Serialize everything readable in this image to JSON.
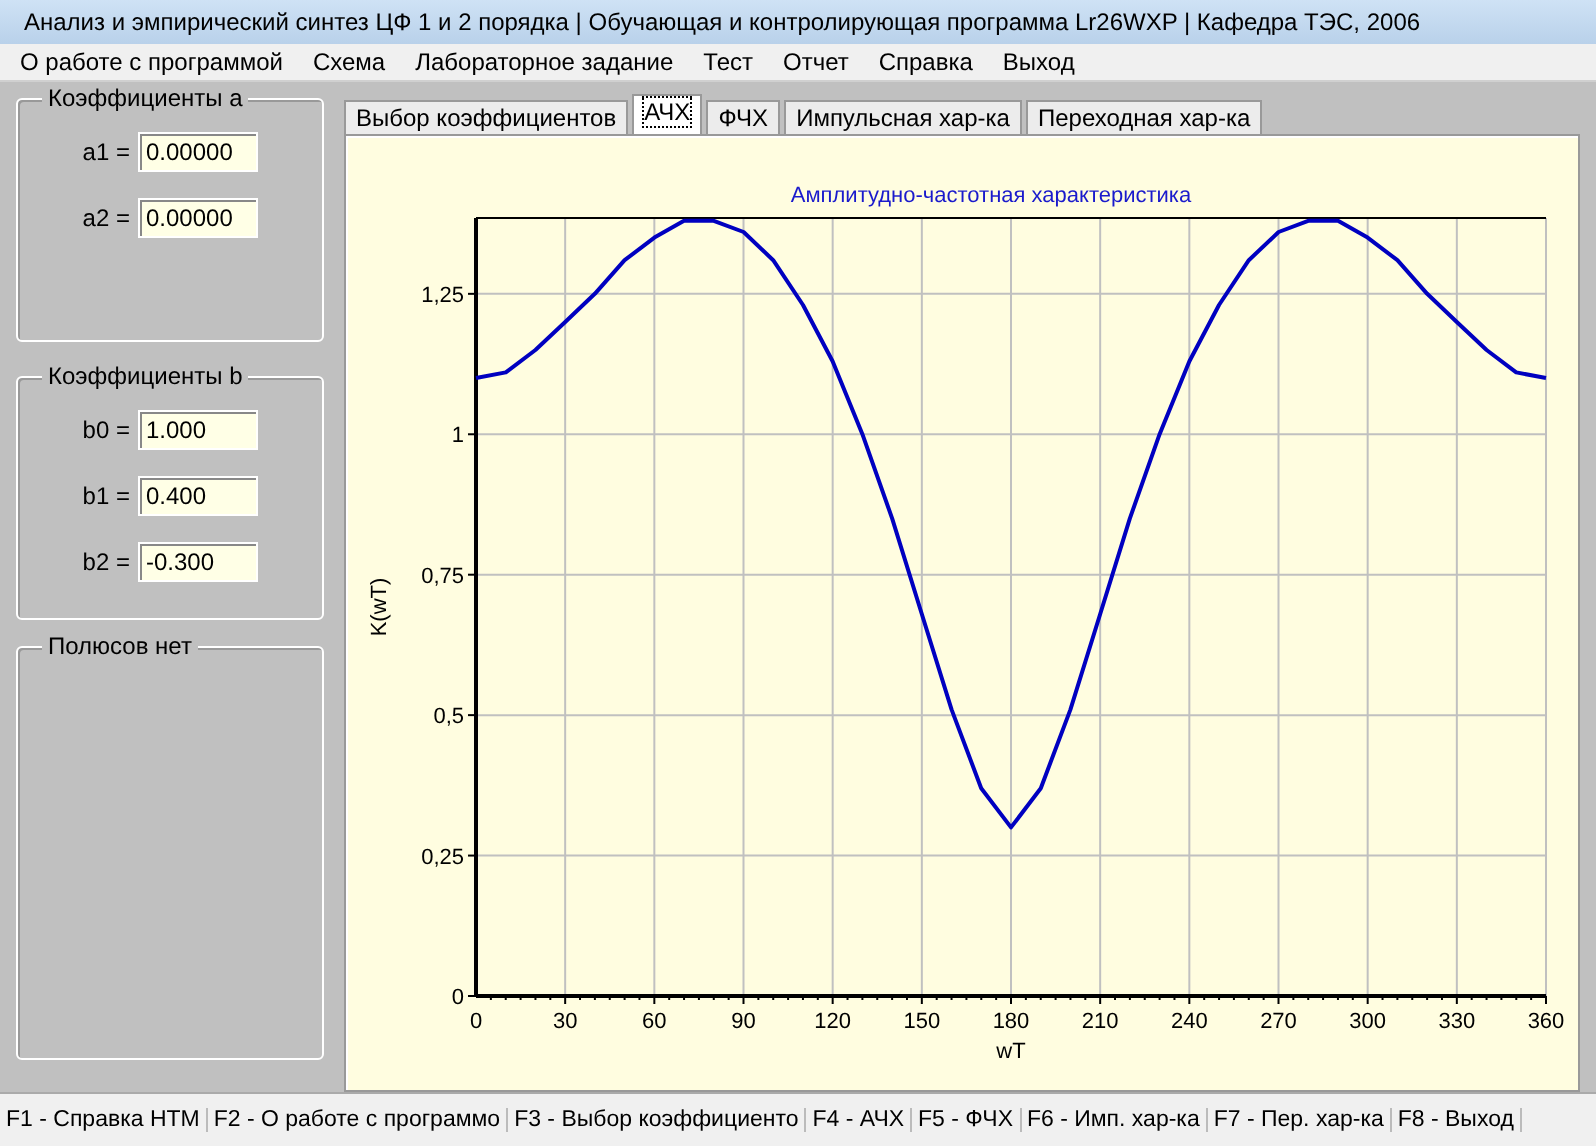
{
  "window": {
    "title": "Анализ и эмпирический синтез ЦФ 1 и 2 порядка | Обучающая и контролирующая программа Lr26WXP | Кафедра ТЭС, 2006"
  },
  "menu": [
    "О работе с программой",
    "Схема",
    "Лабораторное задание",
    "Тест",
    "Отчет",
    "Справка",
    "Выход"
  ],
  "groups": [
    {
      "title": "Коэффициенты  a",
      "fields": [
        {
          "label": "a1 =",
          "value": "0.00000"
        },
        {
          "label": "a2 =",
          "value": "0.00000"
        }
      ]
    },
    {
      "title": "Коэффициенты  b",
      "fields": [
        {
          "label": "b0 =",
          "value": "1.000"
        },
        {
          "label": "b1 =",
          "value": "0.400"
        },
        {
          "label": "b2 =",
          "value": "-0.300"
        }
      ]
    },
    {
      "title": "Полюсов нет"
    }
  ],
  "tabs": [
    {
      "label": "Выбор коэффициентов",
      "selected": false
    },
    {
      "label": "АЧХ",
      "selected": true
    },
    {
      "label": "ФЧХ",
      "selected": false
    },
    {
      "label": "Импульсная хар-ка",
      "selected": false
    },
    {
      "label": "Переходная хар-ка",
      "selected": false
    }
  ],
  "chart_data": {
    "type": "line",
    "title": "Амплитудно-частотная характеристика",
    "xlabel": "wT",
    "ylabel": "K(wT)",
    "x": [
      0,
      10,
      20,
      30,
      40,
      50,
      60,
      70,
      80,
      90,
      100,
      110,
      120,
      130,
      140,
      150,
      160,
      170,
      180,
      190,
      200,
      210,
      220,
      230,
      240,
      250,
      260,
      270,
      280,
      290,
      300,
      310,
      320,
      330,
      340,
      350,
      360
    ],
    "series": [
      {
        "color": "#0000c0",
        "values": [
          1.1,
          1.11,
          1.15,
          1.2,
          1.25,
          1.31,
          1.35,
          1.38,
          1.38,
          1.36,
          1.31,
          1.23,
          1.13,
          1,
          0.85,
          0.68,
          0.51,
          0.37,
          0.3,
          0.37,
          0.51,
          0.68,
          0.85,
          1,
          1.13,
          1.23,
          1.31,
          1.36,
          1.38,
          1.38,
          1.35,
          1.31,
          1.25,
          1.2,
          1.15,
          1.11,
          1.1
        ]
      }
    ],
    "grid": true,
    "xlim": [
      0,
      360
    ],
    "ylim": [
      0,
      1.385
    ],
    "xticks": [
      0,
      30,
      60,
      90,
      120,
      150,
      180,
      210,
      240,
      270,
      300,
      330,
      360
    ],
    "yticks": [
      {
        "value": 0,
        "label": "0"
      },
      {
        "value": 0.25,
        "label": "0,25"
      },
      {
        "value": 0.5,
        "label": "0,5"
      },
      {
        "value": 0.75,
        "label": "0,75"
      },
      {
        "value": 1,
        "label": "1"
      },
      {
        "value": 1.25,
        "label": "1,25"
      }
    ]
  },
  "status_bar": [
    "F1 - Справка HTM",
    "F2 - О работе с программо",
    "F3 - Выбор коэффициенто",
    "F4 - АЧХ",
    "F5 - ФЧХ",
    "F6 - Имп. хар-ка",
    "F7 - Пер. хар-ка",
    "F8 - Выход"
  ]
}
